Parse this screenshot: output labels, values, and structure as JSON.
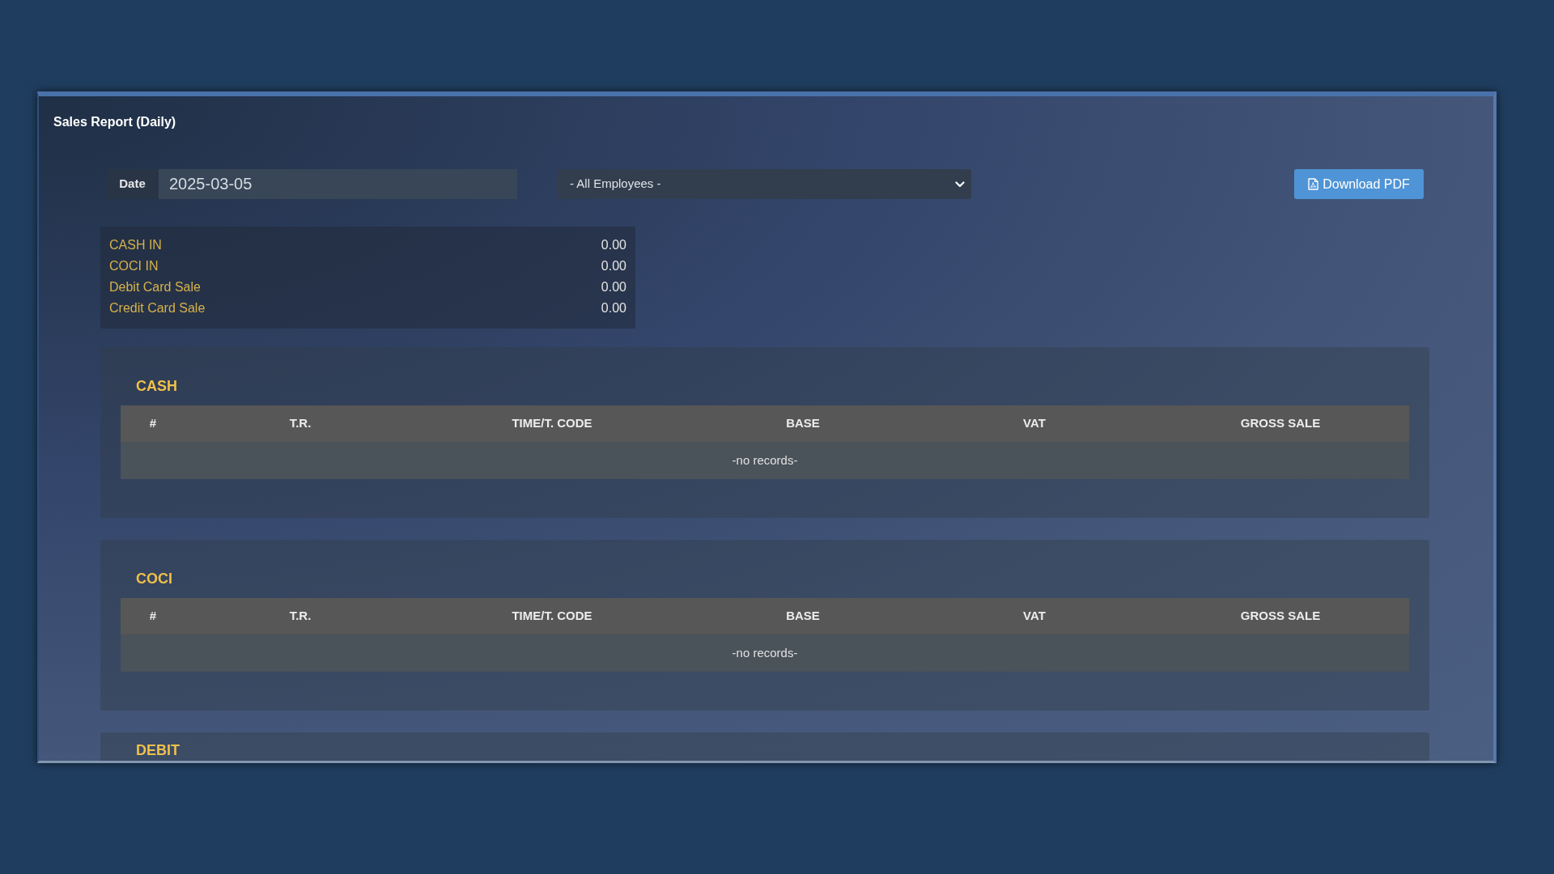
{
  "page_title": "Sales Report (Daily)",
  "filters": {
    "date": {
      "label": "Date",
      "value": "2025-03-05"
    },
    "employee": {
      "value": "- All Employees -"
    },
    "download_button": {
      "label": "Download PDF"
    }
  },
  "totals": [
    {
      "label": "CASH IN",
      "value": "0.00"
    },
    {
      "label": "COCI IN",
      "value": "0.00"
    },
    {
      "label": "Debit Card Sale",
      "value": "0.00"
    },
    {
      "label": "Credit Card Sale",
      "value": "0.00"
    }
  ],
  "sections": [
    {
      "title": "CASH",
      "table": {
        "columns": [
          "#",
          "T.R.",
          "TIME/T. CODE",
          "BASE",
          "VAT",
          "GROSS SALE"
        ],
        "empty_message": "-no records-"
      }
    },
    {
      "title": "COCI",
      "table": {
        "columns": [
          "#",
          "T.R.",
          "TIME/T. CODE",
          "BASE",
          "VAT",
          "GROSS SALE"
        ],
        "empty_message": "-no records-"
      }
    },
    {
      "title": "DEBIT"
    }
  ]
}
